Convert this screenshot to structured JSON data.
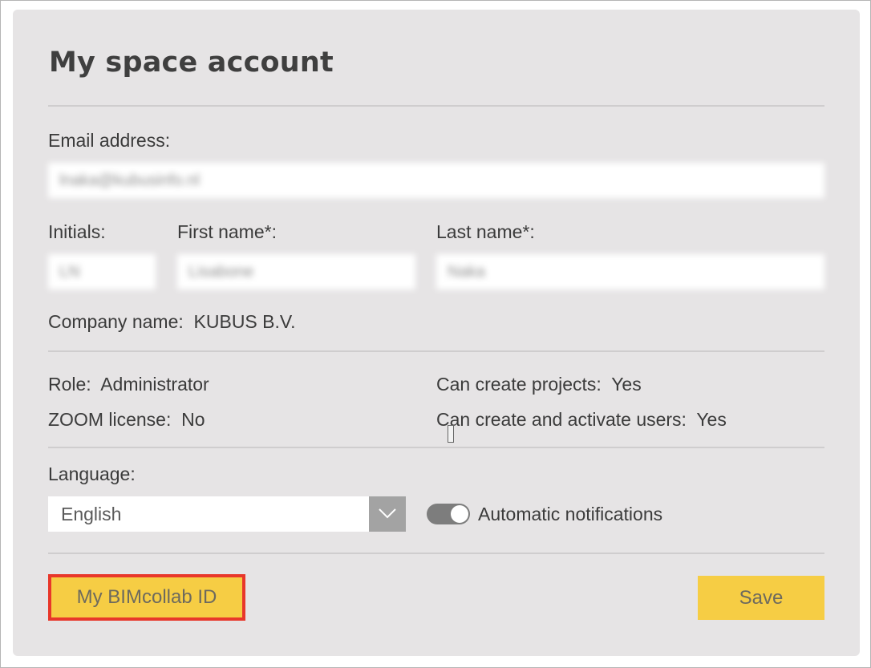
{
  "page": {
    "title": "My space account"
  },
  "form": {
    "email_label": "Email address:",
    "email_value": "lnaka@kubusinfo.nl",
    "initials_label": "Initials:",
    "initials_value": "LN",
    "first_name_label": "First name*:",
    "first_name_value": "Lisabone",
    "last_name_label": "Last name*:",
    "last_name_value": "Naka",
    "company_label": "Company name:",
    "company_value": "KUBUS B.V."
  },
  "permissions": {
    "role_label": "Role:",
    "role_value": "Administrator",
    "zoom_label": "ZOOM license:",
    "zoom_value": "No",
    "create_projects_label": "Can create projects:",
    "create_projects_value": "Yes",
    "create_users_label": "Can create and activate users:",
    "create_users_value": "Yes"
  },
  "settings": {
    "language_label": "Language:",
    "language_selected": "English",
    "notifications_label": "Automatic notifications",
    "notifications_on": true
  },
  "actions": {
    "bimcollab_id_label": "My BIMcollab ID",
    "save_label": "Save"
  },
  "colors": {
    "panel_bg": "#e6e4e5",
    "button_yellow": "#f6cd44",
    "highlight_red": "#e8372a",
    "toggle_on": "#7d7d7d"
  }
}
